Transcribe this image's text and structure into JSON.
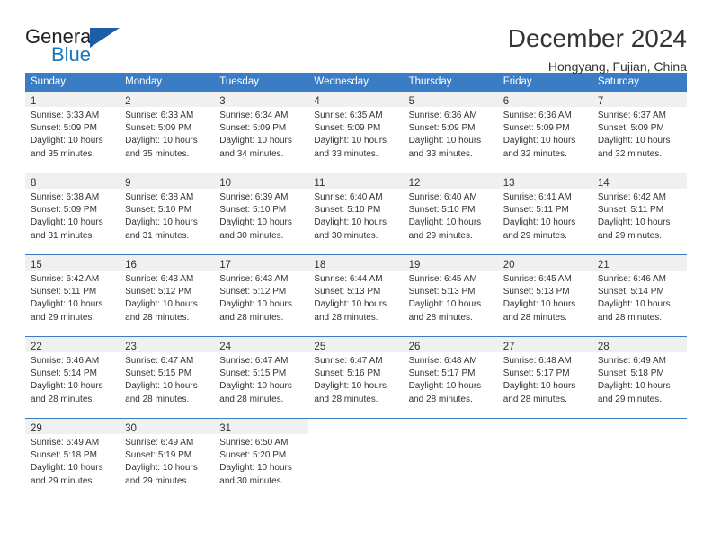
{
  "brand": {
    "name_top": "General",
    "name_bottom": "Blue",
    "accent_color": "#1b75bb",
    "triangle_color": "#1b5fa8"
  },
  "header": {
    "title": "December 2024",
    "subtitle": "Hongyang, Fujian, China"
  },
  "calendar": {
    "header_bg": "#3b7dc4",
    "day_header_bg": "#f0f0f0",
    "weekdays": [
      "Sunday",
      "Monday",
      "Tuesday",
      "Wednesday",
      "Thursday",
      "Friday",
      "Saturday"
    ],
    "weeks": [
      [
        {
          "day": "1",
          "sunrise": "Sunrise: 6:33 AM",
          "sunset": "Sunset: 5:09 PM",
          "daylight1": "Daylight: 10 hours",
          "daylight2": "and 35 minutes."
        },
        {
          "day": "2",
          "sunrise": "Sunrise: 6:33 AM",
          "sunset": "Sunset: 5:09 PM",
          "daylight1": "Daylight: 10 hours",
          "daylight2": "and 35 minutes."
        },
        {
          "day": "3",
          "sunrise": "Sunrise: 6:34 AM",
          "sunset": "Sunset: 5:09 PM",
          "daylight1": "Daylight: 10 hours",
          "daylight2": "and 34 minutes."
        },
        {
          "day": "4",
          "sunrise": "Sunrise: 6:35 AM",
          "sunset": "Sunset: 5:09 PM",
          "daylight1": "Daylight: 10 hours",
          "daylight2": "and 33 minutes."
        },
        {
          "day": "5",
          "sunrise": "Sunrise: 6:36 AM",
          "sunset": "Sunset: 5:09 PM",
          "daylight1": "Daylight: 10 hours",
          "daylight2": "and 33 minutes."
        },
        {
          "day": "6",
          "sunrise": "Sunrise: 6:36 AM",
          "sunset": "Sunset: 5:09 PM",
          "daylight1": "Daylight: 10 hours",
          "daylight2": "and 32 minutes."
        },
        {
          "day": "7",
          "sunrise": "Sunrise: 6:37 AM",
          "sunset": "Sunset: 5:09 PM",
          "daylight1": "Daylight: 10 hours",
          "daylight2": "and 32 minutes."
        }
      ],
      [
        {
          "day": "8",
          "sunrise": "Sunrise: 6:38 AM",
          "sunset": "Sunset: 5:09 PM",
          "daylight1": "Daylight: 10 hours",
          "daylight2": "and 31 minutes."
        },
        {
          "day": "9",
          "sunrise": "Sunrise: 6:38 AM",
          "sunset": "Sunset: 5:10 PM",
          "daylight1": "Daylight: 10 hours",
          "daylight2": "and 31 minutes."
        },
        {
          "day": "10",
          "sunrise": "Sunrise: 6:39 AM",
          "sunset": "Sunset: 5:10 PM",
          "daylight1": "Daylight: 10 hours",
          "daylight2": "and 30 minutes."
        },
        {
          "day": "11",
          "sunrise": "Sunrise: 6:40 AM",
          "sunset": "Sunset: 5:10 PM",
          "daylight1": "Daylight: 10 hours",
          "daylight2": "and 30 minutes."
        },
        {
          "day": "12",
          "sunrise": "Sunrise: 6:40 AM",
          "sunset": "Sunset: 5:10 PM",
          "daylight1": "Daylight: 10 hours",
          "daylight2": "and 29 minutes."
        },
        {
          "day": "13",
          "sunrise": "Sunrise: 6:41 AM",
          "sunset": "Sunset: 5:11 PM",
          "daylight1": "Daylight: 10 hours",
          "daylight2": "and 29 minutes."
        },
        {
          "day": "14",
          "sunrise": "Sunrise: 6:42 AM",
          "sunset": "Sunset: 5:11 PM",
          "daylight1": "Daylight: 10 hours",
          "daylight2": "and 29 minutes."
        }
      ],
      [
        {
          "day": "15",
          "sunrise": "Sunrise: 6:42 AM",
          "sunset": "Sunset: 5:11 PM",
          "daylight1": "Daylight: 10 hours",
          "daylight2": "and 29 minutes."
        },
        {
          "day": "16",
          "sunrise": "Sunrise: 6:43 AM",
          "sunset": "Sunset: 5:12 PM",
          "daylight1": "Daylight: 10 hours",
          "daylight2": "and 28 minutes."
        },
        {
          "day": "17",
          "sunrise": "Sunrise: 6:43 AM",
          "sunset": "Sunset: 5:12 PM",
          "daylight1": "Daylight: 10 hours",
          "daylight2": "and 28 minutes."
        },
        {
          "day": "18",
          "sunrise": "Sunrise: 6:44 AM",
          "sunset": "Sunset: 5:13 PM",
          "daylight1": "Daylight: 10 hours",
          "daylight2": "and 28 minutes."
        },
        {
          "day": "19",
          "sunrise": "Sunrise: 6:45 AM",
          "sunset": "Sunset: 5:13 PM",
          "daylight1": "Daylight: 10 hours",
          "daylight2": "and 28 minutes."
        },
        {
          "day": "20",
          "sunrise": "Sunrise: 6:45 AM",
          "sunset": "Sunset: 5:13 PM",
          "daylight1": "Daylight: 10 hours",
          "daylight2": "and 28 minutes."
        },
        {
          "day": "21",
          "sunrise": "Sunrise: 6:46 AM",
          "sunset": "Sunset: 5:14 PM",
          "daylight1": "Daylight: 10 hours",
          "daylight2": "and 28 minutes."
        }
      ],
      [
        {
          "day": "22",
          "sunrise": "Sunrise: 6:46 AM",
          "sunset": "Sunset: 5:14 PM",
          "daylight1": "Daylight: 10 hours",
          "daylight2": "and 28 minutes."
        },
        {
          "day": "23",
          "sunrise": "Sunrise: 6:47 AM",
          "sunset": "Sunset: 5:15 PM",
          "daylight1": "Daylight: 10 hours",
          "daylight2": "and 28 minutes."
        },
        {
          "day": "24",
          "sunrise": "Sunrise: 6:47 AM",
          "sunset": "Sunset: 5:15 PM",
          "daylight1": "Daylight: 10 hours",
          "daylight2": "and 28 minutes."
        },
        {
          "day": "25",
          "sunrise": "Sunrise: 6:47 AM",
          "sunset": "Sunset: 5:16 PM",
          "daylight1": "Daylight: 10 hours",
          "daylight2": "and 28 minutes."
        },
        {
          "day": "26",
          "sunrise": "Sunrise: 6:48 AM",
          "sunset": "Sunset: 5:17 PM",
          "daylight1": "Daylight: 10 hours",
          "daylight2": "and 28 minutes."
        },
        {
          "day": "27",
          "sunrise": "Sunrise: 6:48 AM",
          "sunset": "Sunset: 5:17 PM",
          "daylight1": "Daylight: 10 hours",
          "daylight2": "and 28 minutes."
        },
        {
          "day": "28",
          "sunrise": "Sunrise: 6:49 AM",
          "sunset": "Sunset: 5:18 PM",
          "daylight1": "Daylight: 10 hours",
          "daylight2": "and 29 minutes."
        }
      ],
      [
        {
          "day": "29",
          "sunrise": "Sunrise: 6:49 AM",
          "sunset": "Sunset: 5:18 PM",
          "daylight1": "Daylight: 10 hours",
          "daylight2": "and 29 minutes."
        },
        {
          "day": "30",
          "sunrise": "Sunrise: 6:49 AM",
          "sunset": "Sunset: 5:19 PM",
          "daylight1": "Daylight: 10 hours",
          "daylight2": "and 29 minutes."
        },
        {
          "day": "31",
          "sunrise": "Sunrise: 6:50 AM",
          "sunset": "Sunset: 5:20 PM",
          "daylight1": "Daylight: 10 hours",
          "daylight2": "and 30 minutes."
        },
        {
          "day": "",
          "sunrise": "",
          "sunset": "",
          "daylight1": "",
          "daylight2": ""
        },
        {
          "day": "",
          "sunrise": "",
          "sunset": "",
          "daylight1": "",
          "daylight2": ""
        },
        {
          "day": "",
          "sunrise": "",
          "sunset": "",
          "daylight1": "",
          "daylight2": ""
        },
        {
          "day": "",
          "sunrise": "",
          "sunset": "",
          "daylight1": "",
          "daylight2": ""
        }
      ]
    ]
  }
}
